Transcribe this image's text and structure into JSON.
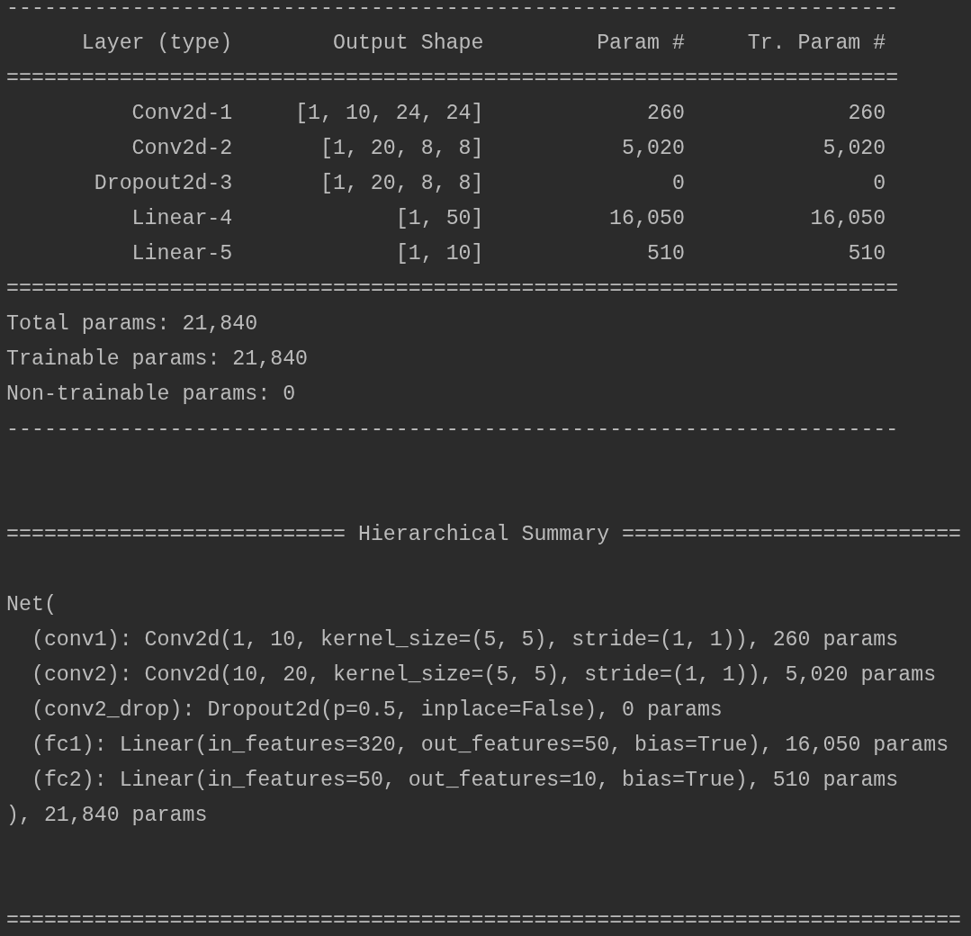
{
  "summary": {
    "rule_top": "-----------------------------------------------------------------------",
    "columns": [
      "Layer (type)",
      "Output Shape",
      "Param #",
      "Tr. Param #"
    ],
    "rule_header": "=======================================================================",
    "rows": [
      [
        "Conv2d-1",
        "[1, 10, 24, 24]",
        "260",
        "260"
      ],
      [
        "Conv2d-2",
        "[1, 20, 8, 8]",
        "5,020",
        "5,020"
      ],
      [
        "Dropout2d-3",
        "[1, 20, 8, 8]",
        "0",
        "0"
      ],
      [
        "Linear-4",
        "[1, 50]",
        "16,050",
        "16,050"
      ],
      [
        "Linear-5",
        "[1, 10]",
        "510",
        "510"
      ]
    ],
    "rule_bottom": "=======================================================================",
    "totals": [
      "Total params: 21,840",
      "Trainable params: 21,840",
      "Non-trainable params: 0"
    ],
    "rule_end": "-----------------------------------------------------------------------"
  },
  "hierarchical": {
    "heading": "=========================== Hierarchical Summary ===========================",
    "root": {
      "text": "Net(",
      "children": [
        {
          "text": "(conv1): Conv2d(1, 10, kernel_size=(5, 5), stride=(1, 1)), 260 params"
        },
        {
          "text": "(conv2): Conv2d(10, 20, kernel_size=(5, 5), stride=(1, 1)), 5,020 params"
        },
        {
          "text": "(conv2_drop): Dropout2d(p=0.5, inplace=False), 0 params"
        },
        {
          "text": "(fc1): Linear(in_features=320, out_features=50, bias=True), 16,050 params"
        },
        {
          "text": "(fc2): Linear(in_features=50, out_features=10, bias=True), 510 params"
        }
      ],
      "close": "), 21,840 params"
    },
    "rule_end": "============================================================================"
  }
}
